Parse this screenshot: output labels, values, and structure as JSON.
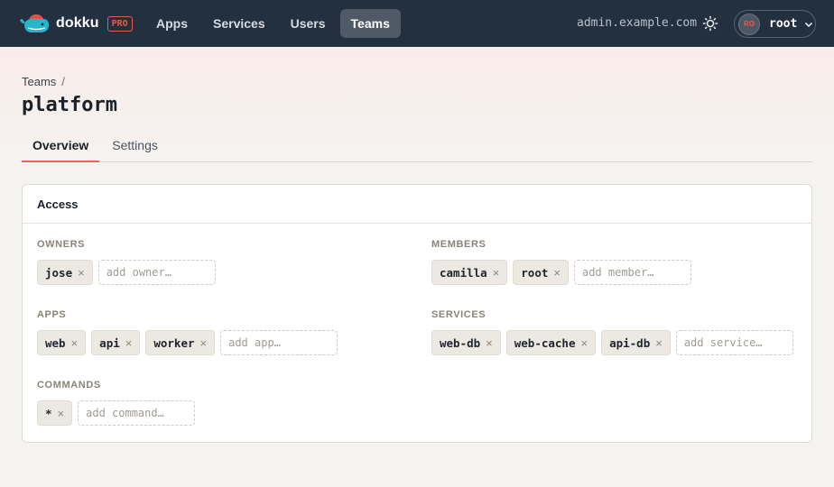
{
  "brand": {
    "name": "dokku",
    "badge": "PRO"
  },
  "nav": {
    "items": [
      "Apps",
      "Services",
      "Users",
      "Teams"
    ],
    "active": "Teams"
  },
  "host": "admin.example.com",
  "user": {
    "initials": "RO",
    "name": "root"
  },
  "breadcrumb": {
    "parent": "Teams",
    "separator": "/"
  },
  "page": {
    "title": "platform"
  },
  "tabs": {
    "overview": "Overview",
    "settings": "Settings",
    "active": "Overview"
  },
  "card": {
    "title": "Access",
    "owners": {
      "label": "OWNERS",
      "chips": [
        "jose"
      ],
      "placeholder": "add owner…"
    },
    "members": {
      "label": "MEMBERS",
      "chips": [
        "camilla",
        "root"
      ],
      "placeholder": "add member…"
    },
    "apps": {
      "label": "APPS",
      "chips": [
        "web",
        "api",
        "worker"
      ],
      "placeholder": "add app…"
    },
    "services": {
      "label": "SERVICES",
      "chips": [
        "web-db",
        "web-cache",
        "api-db"
      ],
      "placeholder": "add service…"
    },
    "commands": {
      "label": "COMMANDS",
      "chips": [
        "*"
      ],
      "placeholder": "add command…"
    }
  },
  "icons": {
    "remove": "×",
    "theme": "sun-icon",
    "dropdown": "chevron-down-icon"
  },
  "colors": {
    "accent": "#e45a50",
    "nav_bg": "#233040",
    "logo": "#25b7c8"
  }
}
